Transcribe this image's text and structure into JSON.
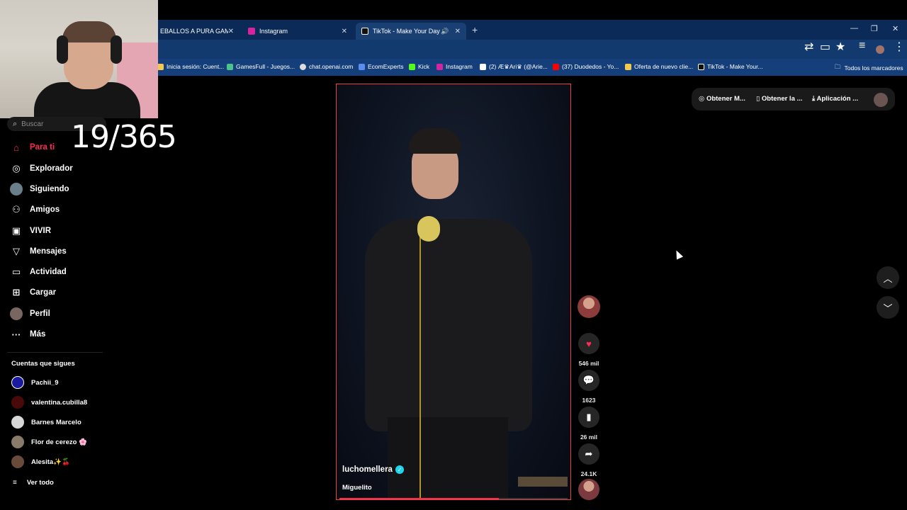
{
  "browser": {
    "tabs": [
      {
        "label": "EBALLOS A PURA GAMBETA",
        "favicon_color": "#e03b3b",
        "active": false
      },
      {
        "label": "Instagram",
        "favicon_color": "#d6249f",
        "active": false
      },
      {
        "label": "TikTok - Make Your Day",
        "favicon_color": "#111111",
        "active": true
      }
    ],
    "new_tab": "+",
    "bookmarks": [
      {
        "label": "Inicia sesión: Cuent...",
        "color": "#f2c94c"
      },
      {
        "label": "GamesFull - Juegos...",
        "color": "#4cc38a"
      },
      {
        "label": "chat.openai.com",
        "color": "#dddddd"
      },
      {
        "label": "EcomExperts",
        "color": "#5b8def"
      },
      {
        "label": "Kick",
        "color": "#53fc18"
      },
      {
        "label": "Instagram",
        "color": "#d6249f"
      },
      {
        "label": "(2) Æ♛Ari♛ (@Arie...",
        "color": "#ffffff"
      },
      {
        "label": "(37) Duodedos - Yo...",
        "color": "#ff0000"
      },
      {
        "label": "Oferta de nuevo clie...",
        "color": "#f2c94c"
      },
      {
        "label": "TikTok - Make Your...",
        "color": "#111111"
      }
    ],
    "all_bookmarks": "Todos los marcadores"
  },
  "overlay": {
    "counter": "19/365"
  },
  "sidebar": {
    "search_placeholder": "Buscar",
    "nav": [
      {
        "label": "Para ti",
        "icon": "home-icon",
        "active": true
      },
      {
        "label": "Explorador",
        "icon": "compass-icon",
        "active": false
      },
      {
        "label": "Siguiendo",
        "icon": "following-icon",
        "active": false
      },
      {
        "label": "Amigos",
        "icon": "friends-icon",
        "active": false
      },
      {
        "label": "VIVIR",
        "icon": "live-icon",
        "active": false
      },
      {
        "label": "Mensajes",
        "icon": "send-icon",
        "active": false
      },
      {
        "label": "Actividad",
        "icon": "activity-icon",
        "active": false
      },
      {
        "label": "Cargar",
        "icon": "upload-icon",
        "active": false
      },
      {
        "label": "Perfil",
        "icon": "profile-icon",
        "active": false
      },
      {
        "label": "Más",
        "icon": "more-icon",
        "active": false
      }
    ],
    "following_title": "Cuentas que sigues",
    "following": [
      {
        "name": "Pachii_9",
        "color": "#1a1aa0"
      },
      {
        "name": "valentina.cubilla8",
        "color": "#4a0a0a"
      },
      {
        "name": "Barnes Marcelo",
        "color": "#d8d8d8"
      },
      {
        "name": "Flor de cerezo 🌸",
        "color": "#8a7a6a"
      },
      {
        "name": "Alesita✨🍒",
        "color": "#6a4a3a"
      }
    ],
    "see_all": "Ver todo"
  },
  "video": {
    "username": "luchomellera",
    "verified": "✓",
    "description": "Miguelito",
    "progress_fraction": 0.7
  },
  "actions": {
    "likes": "546 mil",
    "comments": "1623",
    "saves": "26 mil",
    "shares": "24.1K"
  },
  "topbar": {
    "coins": "Obtener M...",
    "app": "Obtener la ...",
    "download": "Aplicación ..."
  },
  "colors": {
    "accent": "#fe2c55",
    "browser_tabbar": "#0b2a57",
    "browser_bookmarks": "#143f7a"
  }
}
